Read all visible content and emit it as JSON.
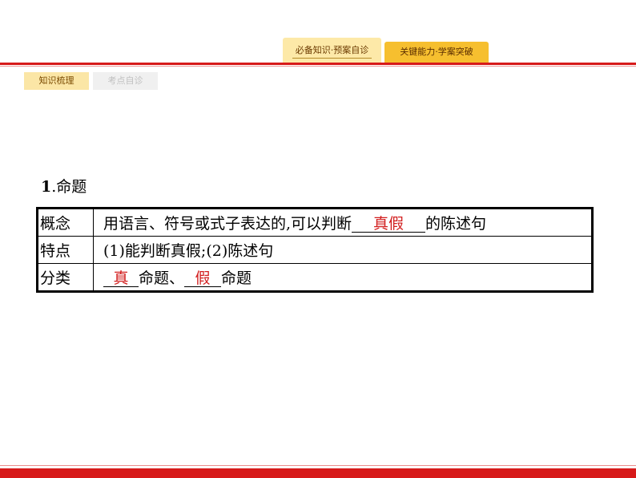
{
  "header": {
    "tabs": [
      {
        "label": "必备知识·预案自诊"
      },
      {
        "label": "关键能力·学案突破"
      }
    ],
    "subtabs": [
      {
        "label": "知识梳理"
      },
      {
        "label": "考点自诊"
      }
    ]
  },
  "section": {
    "number": "1",
    "title": ".命题"
  },
  "table": {
    "rows": [
      {
        "key": "概念",
        "before": "用语言、符号或式子表达的,可以判断",
        "blank": "真假",
        "after": "的陈述句"
      },
      {
        "key": "特点",
        "text": "(1)能判断真假;(2)陈述句"
      },
      {
        "key": "分类",
        "blank1": "真",
        "mid": "命题、",
        "blank2": "假",
        "after": "命题"
      }
    ]
  },
  "colors": {
    "accent_red": "#d71a1a",
    "tab_active": "#fde9a8",
    "tab_highlight": "#f6bf2f",
    "answer_red": "#d21e1e"
  }
}
